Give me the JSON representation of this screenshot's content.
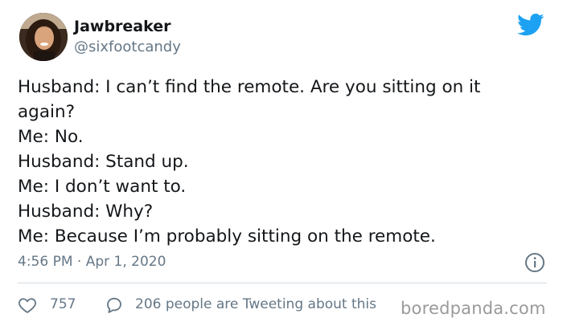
{
  "author": {
    "display_name": "Jawbreaker",
    "handle": "@sixfootcandy",
    "avatar_icon": "profile-photo"
  },
  "brand": {
    "logo_icon": "twitter-bird-icon",
    "accent_color": "#1da1f2"
  },
  "tweet": {
    "lines": [
      "Husband: I can’t find the remote. Are you sitting on it",
      "again?",
      "Me: No.",
      "Husband: Stand up.",
      "Me: I don’t want to.",
      "Husband: Why?",
      "Me: Because I’m probably sitting on the remote."
    ],
    "timestamp": "4:56 PM · Apr 1, 2020"
  },
  "actions": {
    "like_count": "757",
    "tweeting_text": "206 people are Tweeting about this"
  },
  "watermark": {
    "text": "boredpanda.com"
  },
  "colors": {
    "text_primary": "#14171a",
    "text_secondary": "#657786",
    "divider": "#d5dde3"
  }
}
